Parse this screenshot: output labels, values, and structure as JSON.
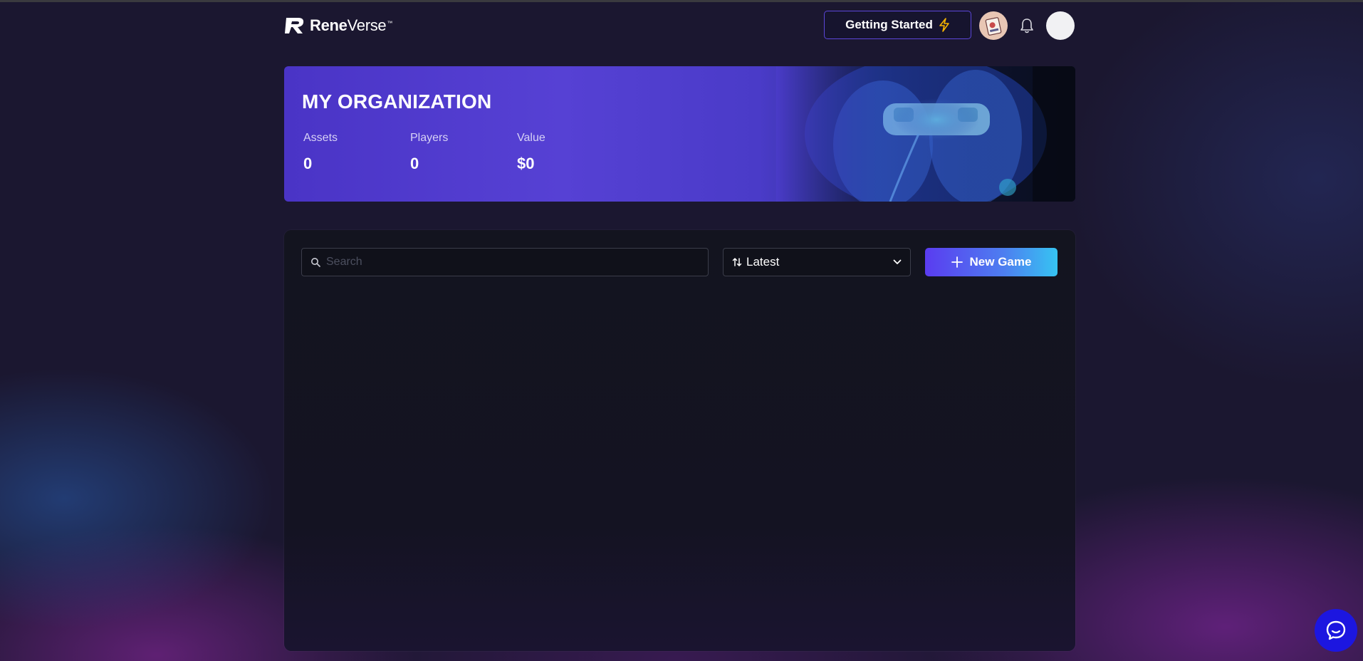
{
  "header": {
    "logo_text_bold": "Rene",
    "logo_text_regular": "Verse",
    "logo_tm": "™",
    "getting_started_label": "Getting Started"
  },
  "banner": {
    "title": "MY ORGANIZATION",
    "stats": [
      {
        "label": "Assets",
        "value": "0"
      },
      {
        "label": "Players",
        "value": "0"
      },
      {
        "label": "Value",
        "value": "$0"
      }
    ]
  },
  "toolbar": {
    "search_placeholder": "Search",
    "search_value": "",
    "sort_selected": "Latest",
    "new_game_label": "New Game"
  },
  "icons": {
    "logo": "reneverse-logo-icon",
    "bolt": "lightning-bolt-icon",
    "bell": "bell-icon",
    "search": "search-icon",
    "sort": "sort-arrows-icon",
    "chevron": "chevron-down-icon",
    "plus": "plus-icon",
    "chat": "chat-bubble-icon"
  },
  "colors": {
    "background": "#1b1730",
    "accent": "#5b46d8",
    "bolt": "#f5b400",
    "chat": "#1c16e0"
  }
}
